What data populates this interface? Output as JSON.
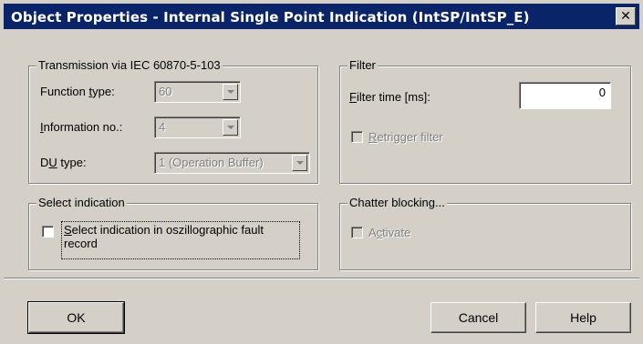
{
  "window": {
    "title": "Object Properties - Internal Single Point Indication (IntSP/IntSP_E)",
    "close_glyph": "✕"
  },
  "transmission": {
    "legend": "Transmission via IEC 60870-5-103",
    "function_type_label": "Function type:",
    "function_type_value": "60",
    "information_no_label": "Information no.:",
    "information_no_value": "4",
    "du_type_label": "DU type:",
    "du_type_value": "1 (Operation Buffer)"
  },
  "filter": {
    "legend": "Filter",
    "filter_time_label": "Filter time [ms]:",
    "filter_time_value": "0",
    "retrigger_label": "Retrigger filter"
  },
  "select_indication": {
    "legend": "Select indication",
    "checkbox_label_line1": "Select indication in oszillographic fault",
    "checkbox_label_line2": "record"
  },
  "chatter_blocking": {
    "legend": "Chatter blocking...",
    "activate_label": "Activate"
  },
  "buttons": {
    "ok": "OK",
    "cancel": "Cancel",
    "help": "Help"
  },
  "colors": {
    "titlebar": "#0a246a",
    "face": "#d4d0c8"
  }
}
